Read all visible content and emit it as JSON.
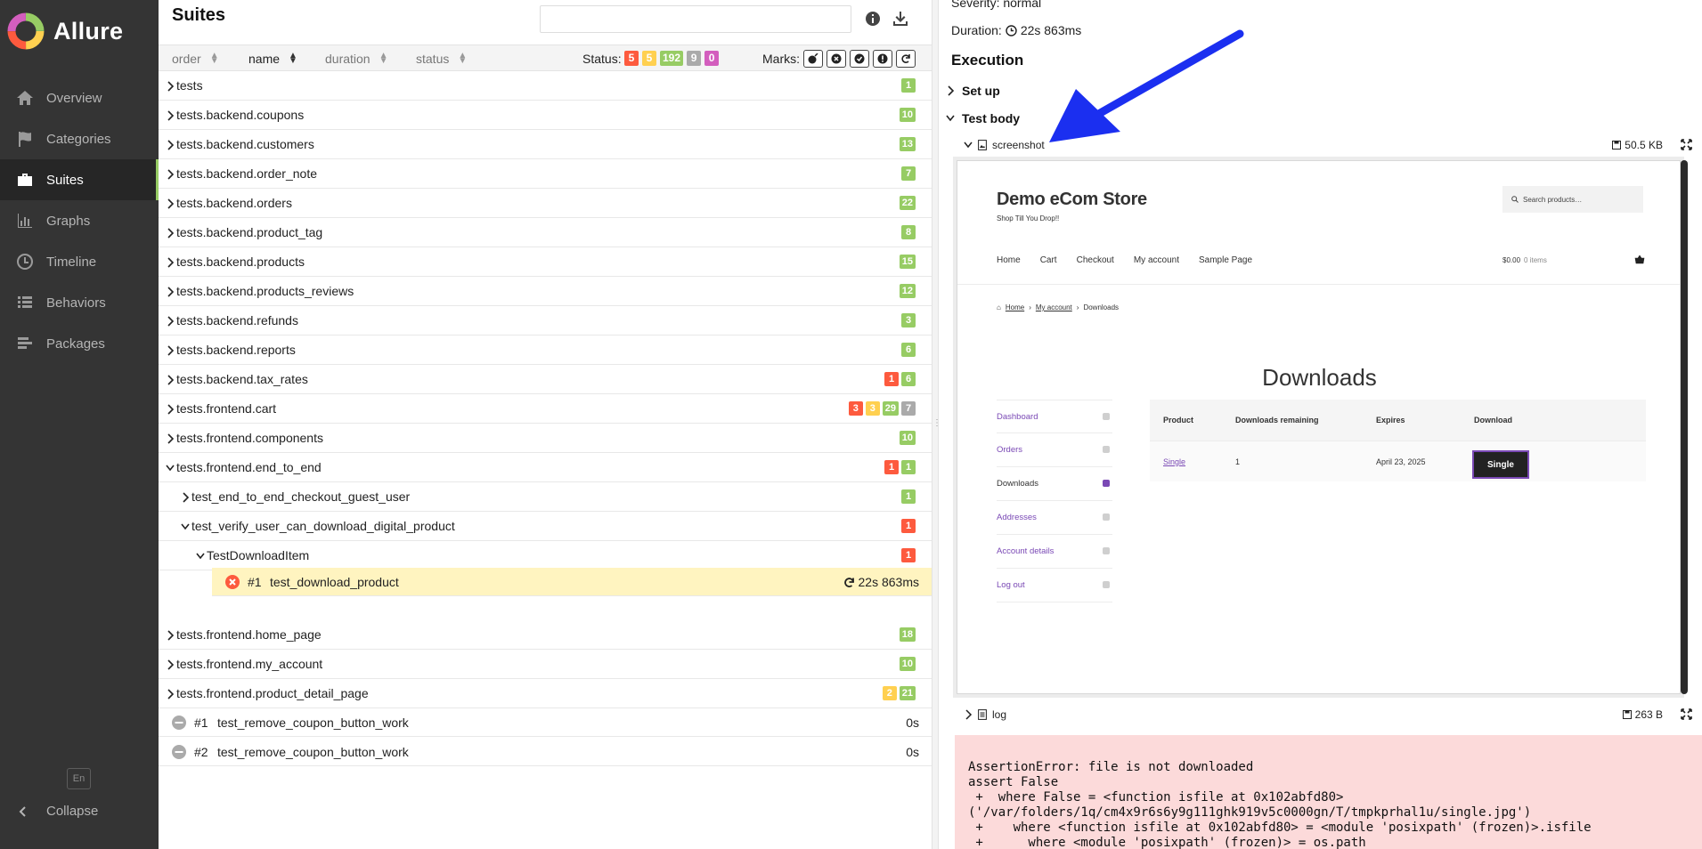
{
  "app": {
    "name": "Allure",
    "logo_colors": [
      "#97cc64",
      "#ffd050",
      "#fd5a3e",
      "#d35ebe",
      "#4a90e2"
    ]
  },
  "sidebar": {
    "items": [
      {
        "label": "Overview",
        "icon": "home-icon"
      },
      {
        "label": "Categories",
        "icon": "flag-icon"
      },
      {
        "label": "Suites",
        "icon": "briefcase-icon",
        "active": true
      },
      {
        "label": "Graphs",
        "icon": "bar-chart-icon"
      },
      {
        "label": "Timeline",
        "icon": "clock-icon"
      },
      {
        "label": "Behaviors",
        "icon": "list-icon"
      },
      {
        "label": "Packages",
        "icon": "stack-icon"
      }
    ],
    "language": "En",
    "collapse_label": "Collapse"
  },
  "suites": {
    "title": "Suites",
    "search_placeholder": "",
    "sort": {
      "order": "order",
      "name": "name",
      "duration": "duration",
      "status": "status"
    },
    "status_label": "Status:",
    "status_counts": [
      {
        "value": "5",
        "color": "#fd5a3e"
      },
      {
        "value": "5",
        "color": "#ffd050"
      },
      {
        "value": "192",
        "color": "#97cc64"
      },
      {
        "value": "9",
        "color": "#aaaaaa"
      },
      {
        "value": "0",
        "color": "#d35ebe"
      }
    ],
    "marks_label": "Marks:",
    "marks": [
      "flaky-icon",
      "new-failed-icon",
      "new-passed-icon",
      "new-broken-icon",
      "retries-icon"
    ],
    "rows": [
      {
        "label": "tests",
        "expanded": false,
        "counts": [
          {
            "v": "1",
            "c": "green"
          }
        ]
      },
      {
        "label": "tests.backend.coupons",
        "expanded": false,
        "counts": [
          {
            "v": "10",
            "c": "green"
          }
        ]
      },
      {
        "label": "tests.backend.customers",
        "expanded": false,
        "counts": [
          {
            "v": "13",
            "c": "green"
          }
        ]
      },
      {
        "label": "tests.backend.order_note",
        "expanded": false,
        "counts": [
          {
            "v": "7",
            "c": "green"
          }
        ]
      },
      {
        "label": "tests.backend.orders",
        "expanded": false,
        "counts": [
          {
            "v": "22",
            "c": "green"
          }
        ]
      },
      {
        "label": "tests.backend.product_tag",
        "expanded": false,
        "counts": [
          {
            "v": "8",
            "c": "green"
          }
        ]
      },
      {
        "label": "tests.backend.products",
        "expanded": false,
        "counts": [
          {
            "v": "15",
            "c": "green"
          }
        ]
      },
      {
        "label": "tests.backend.products_reviews",
        "expanded": false,
        "counts": [
          {
            "v": "12",
            "c": "green"
          }
        ]
      },
      {
        "label": "tests.backend.refunds",
        "expanded": false,
        "counts": [
          {
            "v": "3",
            "c": "green"
          }
        ]
      },
      {
        "label": "tests.backend.reports",
        "expanded": false,
        "counts": [
          {
            "v": "6",
            "c": "green"
          }
        ]
      },
      {
        "label": "tests.backend.tax_rates",
        "expanded": false,
        "counts": [
          {
            "v": "1",
            "c": "red"
          },
          {
            "v": "6",
            "c": "green"
          }
        ]
      },
      {
        "label": "tests.frontend.cart",
        "expanded": false,
        "counts": [
          {
            "v": "3",
            "c": "red"
          },
          {
            "v": "3",
            "c": "orange"
          },
          {
            "v": "29",
            "c": "green"
          },
          {
            "v": "7",
            "c": "grey"
          }
        ]
      },
      {
        "label": "tests.frontend.components",
        "expanded": false,
        "counts": [
          {
            "v": "10",
            "c": "green"
          }
        ]
      },
      {
        "label": "tests.frontend.end_to_end",
        "expanded": true,
        "counts": [
          {
            "v": "1",
            "c": "red"
          },
          {
            "v": "1",
            "c": "green"
          }
        ]
      },
      {
        "label": "test_end_to_end_checkout_guest_user",
        "expanded": false,
        "indent": 1,
        "counts": [
          {
            "v": "1",
            "c": "green"
          }
        ]
      },
      {
        "label": "test_verify_user_can_download_digital_product",
        "expanded": true,
        "indent": 1,
        "counts": [
          {
            "v": "1",
            "c": "red"
          }
        ]
      },
      {
        "label": "TestDownloadItem",
        "expanded": true,
        "indent": 2,
        "counts": [
          {
            "v": "1",
            "c": "red"
          }
        ]
      }
    ],
    "selected_leaf": {
      "num": "#1",
      "name": "test_download_product",
      "duration": "22s 863ms"
    },
    "rows_after": [
      {
        "label": "tests.frontend.home_page",
        "expanded": false,
        "counts": [
          {
            "v": "18",
            "c": "green"
          }
        ]
      },
      {
        "label": "tests.frontend.my_account",
        "expanded": false,
        "counts": [
          {
            "v": "10",
            "c": "green"
          }
        ]
      },
      {
        "label": "tests.frontend.product_detail_page",
        "expanded": false,
        "counts": [
          {
            "v": "2",
            "c": "orange"
          },
          {
            "v": "21",
            "c": "green"
          }
        ]
      }
    ],
    "skipped_leaves": [
      {
        "num": "#1",
        "name": "test_remove_coupon_button_work",
        "duration": "0s"
      },
      {
        "num": "#2",
        "name": "test_remove_coupon_button_work",
        "duration": "0s"
      }
    ]
  },
  "detail": {
    "severity": "Severity: normal",
    "duration_label": "Duration:",
    "duration": "22s 863ms",
    "execution_title": "Execution",
    "setup_label": "Set up",
    "testbody_label": "Test body",
    "attachment1": {
      "name": "screenshot",
      "size": "50.5 KB"
    },
    "attachment2": {
      "name": "log",
      "size": "263 B"
    },
    "error_text": "AssertionError: file is not downloaded\nassert False\n +  where False = <function isfile at 0x102abfd80>\n('/var/folders/1q/cm4x9r6s6y9g111ghk919v5c0000gn/T/tmpkprhal1u/single.jpg')\n +    where <function isfile at 0x102abfd80> = <module 'posixpath' (frozen)>.isfile\n +      where <module 'posixpath' (frozen)> = os.path"
  },
  "screenshot": {
    "store_name": "Demo eCom Store",
    "tagline": "Shop Till You Drop!!",
    "search_placeholder": "Search products…",
    "menu": [
      "Home",
      "Cart",
      "Checkout",
      "My account",
      "Sample Page"
    ],
    "cart_total": "$0.00",
    "cart_items": "0 items",
    "breadcrumb": [
      "Home",
      "My account",
      "Downloads"
    ],
    "heading": "Downloads",
    "account_nav": [
      {
        "label": "Dashboard",
        "icon": "dashboard-icon"
      },
      {
        "label": "Orders",
        "icon": "basket-icon"
      },
      {
        "label": "Downloads",
        "icon": "file-icon",
        "current": true
      },
      {
        "label": "Addresses",
        "icon": "house-icon"
      },
      {
        "label": "Account details",
        "icon": "user-icon"
      },
      {
        "label": "Log out",
        "icon": "logout-icon"
      }
    ],
    "table_headers": [
      "Product",
      "Downloads remaining",
      "Expires",
      "Download"
    ],
    "table_row": {
      "product": "Single",
      "remaining": "1",
      "expires": "April 23, 2025",
      "button": "Single"
    }
  },
  "annotation_arrow_color": "#1b2ff0"
}
